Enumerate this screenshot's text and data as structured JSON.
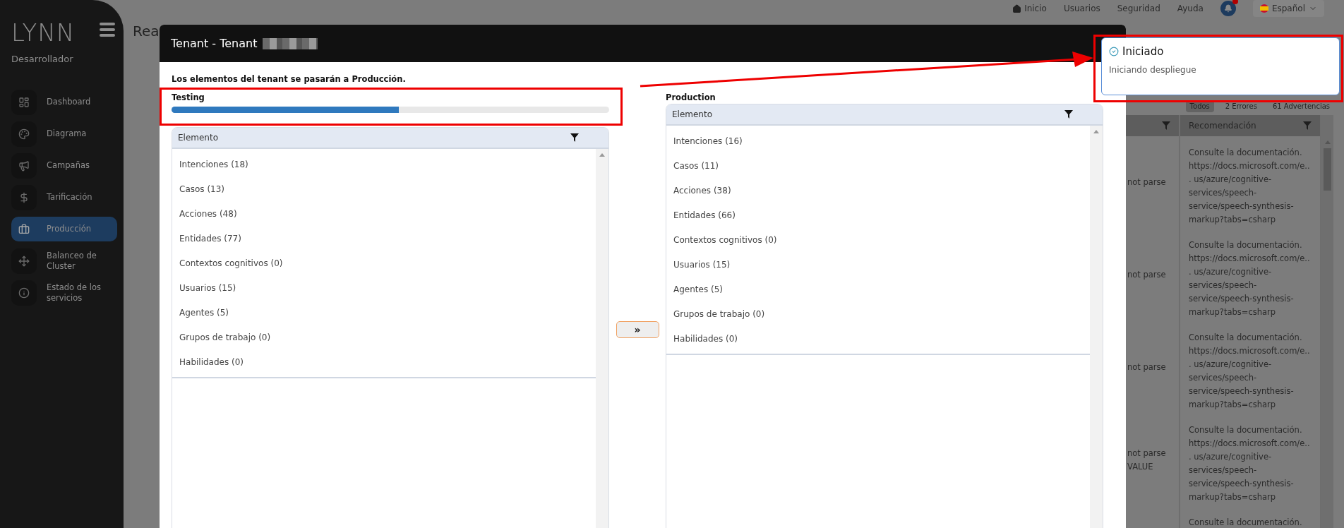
{
  "sidebar": {
    "logo": "LYNN",
    "role": "Desarrollador",
    "items": [
      {
        "label": "Dashboard",
        "selected": false
      },
      {
        "label": "Diagrama",
        "selected": false
      },
      {
        "label": "Campañas",
        "selected": false
      },
      {
        "label": "Tarificación",
        "selected": false
      },
      {
        "label": "Producción",
        "selected": true
      },
      {
        "label": "Balanceo de Cluster",
        "selected": false
      },
      {
        "label": "Estado de los servicios",
        "selected": false
      }
    ]
  },
  "top_nav": {
    "links": [
      {
        "label": "Inicio",
        "kind": "home"
      },
      {
        "label": "Usuarios",
        "kind": "plain"
      },
      {
        "label": "Seguridad",
        "kind": "plain"
      },
      {
        "label": "Ayuda",
        "kind": "plain"
      }
    ],
    "notification": {
      "unread": true
    },
    "language": "Español"
  },
  "page": {
    "title": "Rea",
    "filters": [
      {
        "label": "Todos",
        "selected": true
      },
      {
        "label": "2 Errores",
        "selected": false
      },
      {
        "label": "61 Advertencias",
        "selected": false
      }
    ],
    "table": {
      "columns": [
        {
          "filterable": true
        },
        {
          "label": "Recomendación",
          "filterable": true
        }
      ],
      "rows": [
        {
          "column_1": "not parse",
          "recomendacion": "Consulte la documentación. https://docs.microsoft.com/e... us/azure/cognitive-services/speech-service/speech-synthesis-markup?tabs=csharp"
        },
        {
          "column_1": "not parse",
          "recomendacion": "Consulte la documentación. https://docs.microsoft.com/e... us/azure/cognitive-services/speech-service/speech-synthesis-markup?tabs=csharp"
        },
        {
          "column_1": "not parse",
          "recomendacion": "Consulte la documentación. https://docs.microsoft.com/e... us/azure/cognitive-services/speech-service/speech-synthesis-markup?tabs=csharp"
        },
        {
          "column_1": "not parse VALUE",
          "recomendacion": "Consulte la documentación. https://docs.microsoft.com/e... us/azure/cognitive-services/speech-service/speech-synthesis-markup?tabs=csharp"
        },
        {
          "column_1": "",
          "recomendacion": "Consulte la documentación."
        }
      ]
    }
  },
  "modal": {
    "title": "Tenant - Tenant",
    "message": "Los elementos del tenant se pasarán a Producción.",
    "source": {
      "label": "Testing",
      "level": 0.52,
      "column": "Elemento",
      "items": [
        "Intenciones (18)",
        "Casos (13)",
        "Acciones (48)",
        "Entidades (77)",
        "Contextos cognitivos (0)",
        "Usuarios (15)",
        "Agentes (5)",
        "Grupos de trabajo (0)",
        "Habilidades (0)"
      ]
    },
    "transfer_button": "»",
    "target": {
      "label": "Production",
      "column": "Elemento",
      "items": [
        "Intenciones (16)",
        "Casos (11)",
        "Acciones (38)",
        "Entidades (66)",
        "Contextos cognitivos (0)",
        "Usuarios (15)",
        "Agentes (5)",
        "Grupos de trabajo (0)",
        "Habilidades (0)"
      ]
    }
  },
  "toast": {
    "title": "Iniciado",
    "message": "Iniciando despliegue"
  }
}
